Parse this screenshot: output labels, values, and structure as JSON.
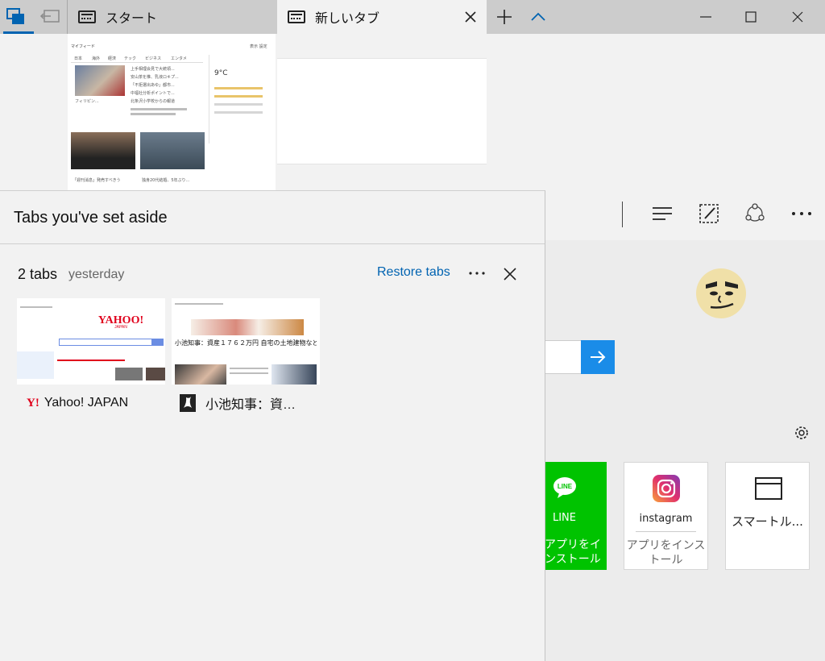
{
  "tabbar": {
    "tabs": [
      {
        "label": "スタート"
      },
      {
        "label": "新しいタブ"
      }
    ]
  },
  "start_preview": {
    "header": "マイフィード",
    "header_right": "表示 設定",
    "categories": [
      "日本",
      "海外",
      "経済",
      "テック",
      "ビジネス",
      "エンタメ"
    ],
    "headlines": [
      "上手相理会見で大統領...",
      "安山茶を推、乳液ロキプ...",
      "「不拒選出あゆ」都市...",
      "中福社分析ポイントで...",
      "北条沢小学校からの報道"
    ],
    "weather_temp": "9°C",
    "story1_title": "「週刊消息」発売すべきう",
    "story2_title": "独身20代結婚、5年ぶり..."
  },
  "aside": {
    "title": "Tabs you've set aside",
    "group_count": "2 tabs",
    "group_date": "yesterday",
    "restore_label": "Restore tabs",
    "tabs": [
      {
        "title": "Yahoo! JAPAN",
        "favicon_text": "Y!"
      },
      {
        "title": "小池知事：資…",
        "headline": "小池知事：資産１７６２万円 自宅の土地建物など"
      }
    ]
  },
  "background": {
    "tiles": [
      {
        "name": "LINE",
        "sub": "アプリをインストール"
      },
      {
        "name": "instagram",
        "sub": "アプリをインストール"
      },
      {
        "name": "スマートル..."
      }
    ]
  },
  "colors": {
    "accent": "#0063b1",
    "line_green": "#00c300",
    "search_blue": "#1a8ce8"
  }
}
